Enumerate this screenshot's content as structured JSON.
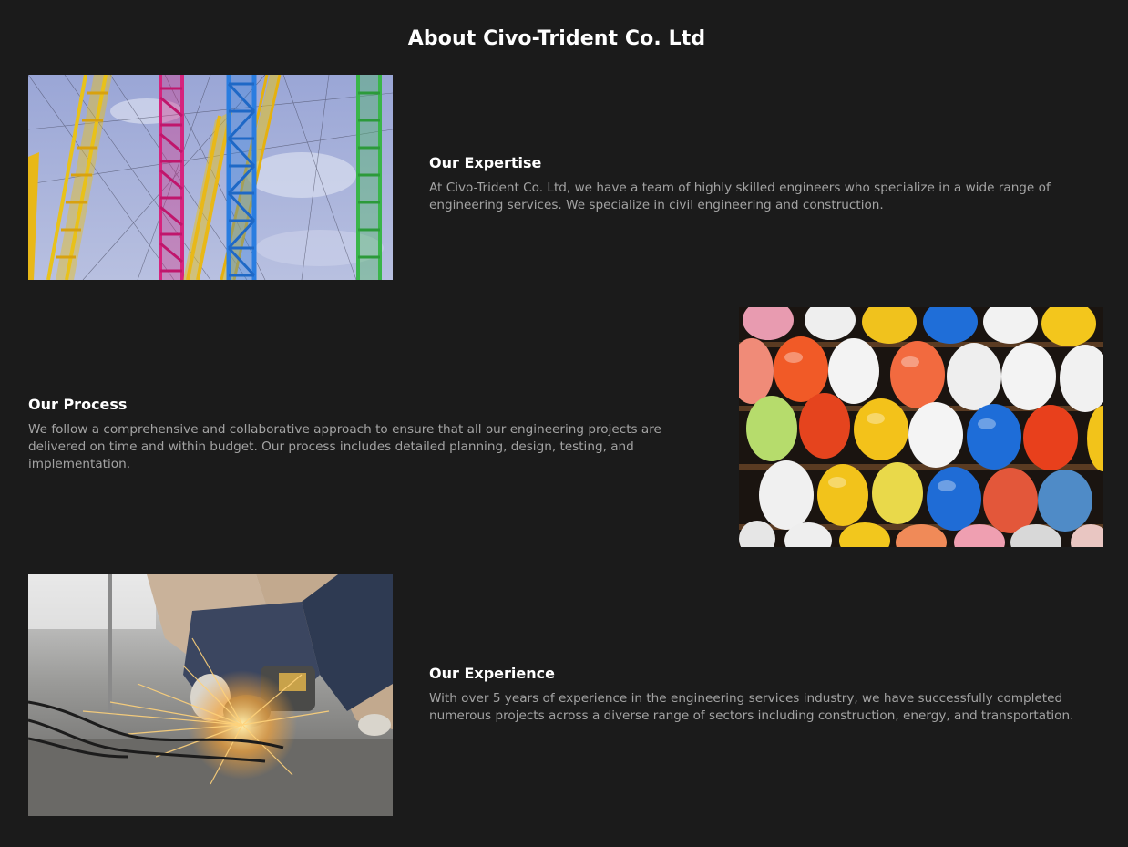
{
  "page": {
    "title": "About Civo-Trident Co. Ltd"
  },
  "sections": [
    {
      "heading": "Our Expertise",
      "body": "At Civo-Trident Co. Ltd, we have a team of highly skilled engineers who specialize in a wide range of engineering services. We specialize in civil engineering and construction.",
      "image": "colorful-cranes-photo"
    },
    {
      "heading": "Our Process",
      "body": "We follow a comprehensive and collaborative approach to ensure that all our engineering projects are delivered on time and within budget. Our process includes detailed planning, design, testing, and implementation.",
      "image": "hard-hats-photo"
    },
    {
      "heading": "Our Experience",
      "body": "With over 5 years of experience in the engineering services industry, we have successfully completed numerous projects across a diverse range of sectors including construction, energy, and transportation.",
      "image": "angle-grinder-sparks-photo"
    }
  ],
  "colors": {
    "background": "#1b1b1b",
    "heading": "#ffffff",
    "body_text": "#a3a3a3"
  }
}
